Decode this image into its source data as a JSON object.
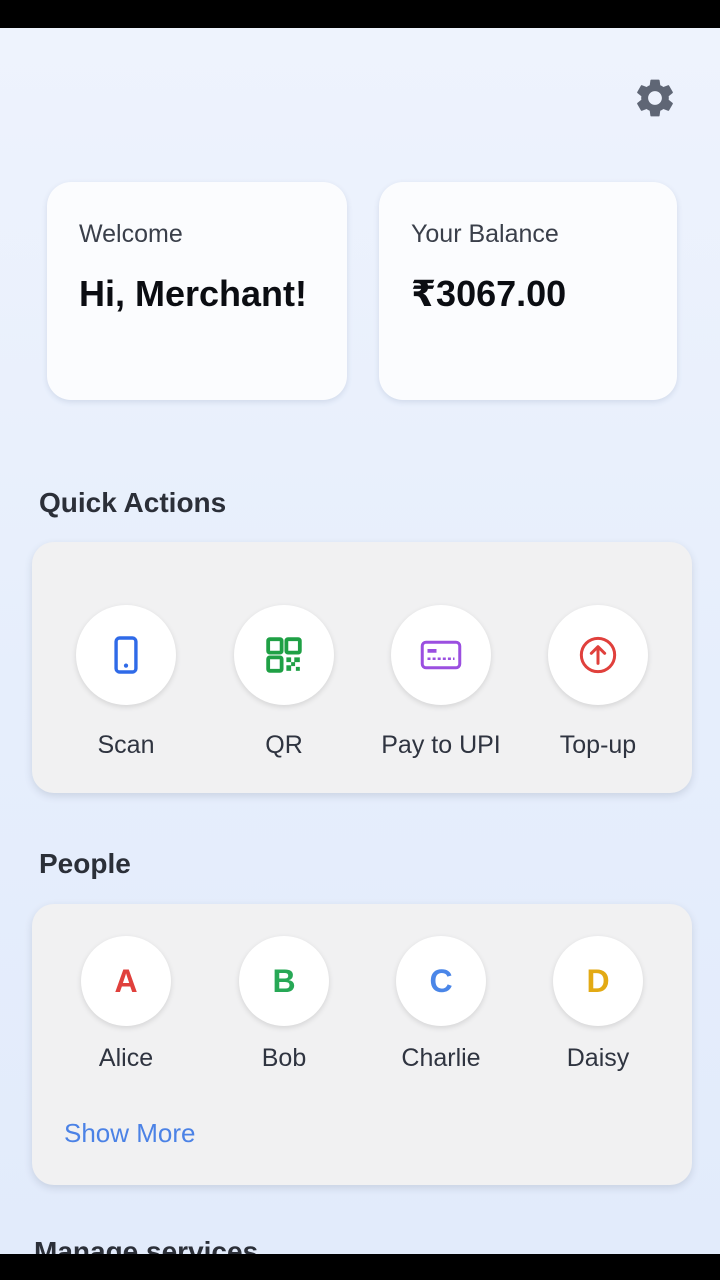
{
  "header": {
    "settings_icon": "gear-icon",
    "settings_color": "#5f6675"
  },
  "welcome_card": {
    "label": "Welcome",
    "greeting": "Hi, Merchant!"
  },
  "balance_card": {
    "label": "Your Balance",
    "amount": "₹3067.00"
  },
  "quick_actions": {
    "title": "Quick Actions",
    "items": [
      {
        "label": "Scan",
        "icon": "phone-icon",
        "color": "#2f6ae8"
      },
      {
        "label": "QR",
        "icon": "qr-code-icon",
        "color": "#1fa045"
      },
      {
        "label": "Pay to UPI",
        "icon": "card-icon",
        "color": "#9b4fe0"
      },
      {
        "label": "Top-up",
        "icon": "arrow-up-circle-icon",
        "color": "#e0403c"
      }
    ]
  },
  "people": {
    "title": "People",
    "items": [
      {
        "initial": "A",
        "name": "Alice",
        "color": "#e0403c"
      },
      {
        "initial": "B",
        "name": "Bob",
        "color": "#27a856"
      },
      {
        "initial": "C",
        "name": "Charlie",
        "color": "#4a86e8"
      },
      {
        "initial": "D",
        "name": "Daisy",
        "color": "#e3aa14"
      }
    ],
    "show_more": "Show More"
  },
  "manage_services": {
    "title": "Manage services"
  }
}
